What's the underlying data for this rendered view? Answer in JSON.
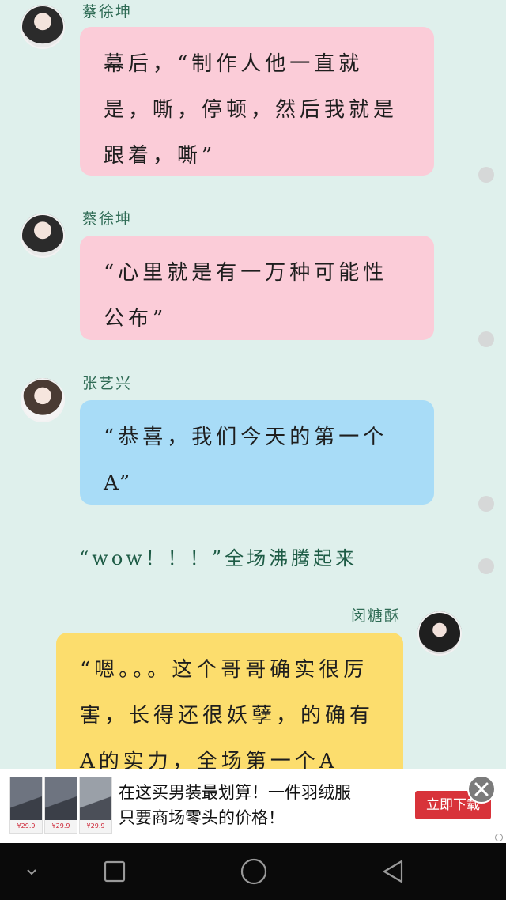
{
  "messages": [
    {
      "sender": "蔡徐坤",
      "text": "幕后，“制作人他一直就是，嘶，停顿，然后我就是跟着，嘶”"
    },
    {
      "sender": "蔡徐坤",
      "text": "“心里就是有一万种可能性公布”"
    },
    {
      "sender": "张艺兴",
      "text": "“恭喜，我们今天的第一个A”"
    },
    {
      "sender": "闵糖酥",
      "text": "“嗯。。。这个哥哥确实很厉害，长得还很妖孽，的确有A的实力，全场第一个A"
    }
  ],
  "narration": "“wow！！！”全场沸腾起来",
  "ad": {
    "line1": "在这买男装最划算！一件羽绒服",
    "line2": "只要商场零头的价格！",
    "button": "立即下载",
    "thumb_price": "¥29.9"
  },
  "icons": {
    "close": "close-icon",
    "back": "back-icon",
    "home": "home-icon",
    "recents": "recents-icon",
    "nav_down": "chevron-down-icon"
  },
  "colors": {
    "background": "#dff0ec",
    "pink_bubble": "#fbccd8",
    "blue_bubble": "#a8dcf7",
    "yellow_bubble": "#fcdd6d",
    "ad_button": "#d8333a"
  }
}
